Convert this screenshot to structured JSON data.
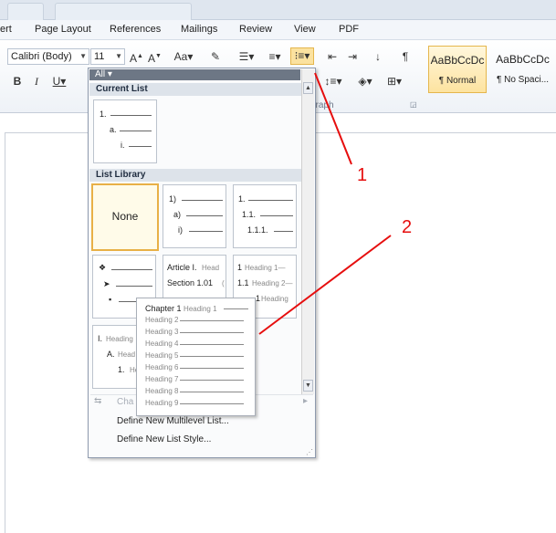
{
  "window": {
    "tab_1": "",
    "tab_2": ""
  },
  "menu": [
    "ert",
    "Page Layout",
    "References",
    "Mailings",
    "Review",
    "View",
    "PDF"
  ],
  "font": {
    "name": "Calibri (Body)",
    "size": "11"
  },
  "ribbon": {
    "paragraph_label": "graph",
    "styles": [
      {
        "preview": "AaBbCcDc",
        "name": "¶ Normal"
      },
      {
        "preview": "AaBbCcDc",
        "name": "¶ No Spaci..."
      }
    ]
  },
  "gallery": {
    "filter": "All ▾",
    "current_list_header": "Current List",
    "list_library_header": "List Library",
    "current_list": [
      "1.",
      "a.",
      "i."
    ],
    "none_label": "None",
    "tile_numbered": [
      "1)",
      "a)",
      "i)"
    ],
    "tile_legal": [
      "1.",
      "1.1.",
      "1.1.1."
    ],
    "tile_article": {
      "line1": "Article I.",
      "tag1": "Head",
      "line2": "Section 1.01",
      "tag2": "("
    },
    "tile_heading_num": {
      "line1": "1",
      "tag1": "Heading 1—",
      "line2": "1.1",
      "tag2": "Heading 2—",
      "line3": "1",
      "tag3": "Heading"
    },
    "tile_roman": {
      "line1": "I.",
      "tag1": "Heading",
      "line2": "A.",
      "tag2": "Head",
      "line3": "1.",
      "tag3": "He"
    },
    "commands": {
      "change_level": "Cha",
      "define_multilevel": "Define New Multilevel List...",
      "define_style": "Define New List Style..."
    }
  },
  "tooltip": {
    "first_bold": "Chapter 1",
    "first_tag": "Heading 1",
    "rows": [
      "Heading 2",
      "Heading 3",
      "Heading 4",
      "Heading 5",
      "Heading 6",
      "Heading 7",
      "Heading 8",
      "Heading 9"
    ]
  },
  "annotations": {
    "label_1": "1",
    "label_2": "2",
    "color": "#e60e0e"
  }
}
